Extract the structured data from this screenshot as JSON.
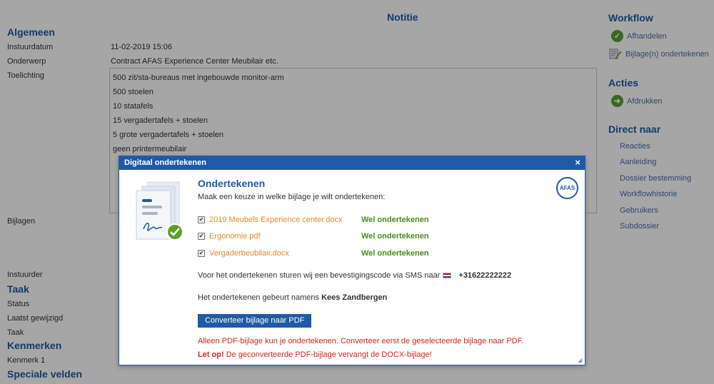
{
  "page": {
    "title": "Notitie"
  },
  "general": {
    "heading": "Algemeen",
    "fields": [
      {
        "label": "Instuurdatum",
        "value": "11-02-2019 15:06"
      },
      {
        "label": "Onderwerp",
        "value": "Contract AFAS Experience Center Meubilair etc."
      },
      {
        "label": "Toelichting",
        "value": ""
      }
    ],
    "description_lines": [
      "500 zit/sta-bureaus met ingebouwde monitor-arm",
      "500 stoelen",
      "10 statafels",
      "15 vergadertafels + stoelen",
      "5 grote vergadertafels + stoelen",
      "geen printermeubilair"
    ],
    "attachments_label": "Bijlagen",
    "submitter_label": "Instuurder"
  },
  "task": {
    "heading": "Taak",
    "fields": [
      "Status",
      "Laatst gewijzigd",
      "Taak"
    ]
  },
  "features": {
    "heading": "Kenmerken",
    "fields": [
      "Kenmerk 1"
    ]
  },
  "special": {
    "heading": "Speciale velden"
  },
  "workflow": {
    "heading": "Workflow",
    "items": [
      "Afhandelen",
      "Bijlage(n) ondertekenen"
    ]
  },
  "actions": {
    "heading": "Acties",
    "items": [
      "Afdrukken"
    ]
  },
  "direct": {
    "heading": "Direct naar",
    "items": [
      "Reacties",
      "Aanleiding",
      "Dossier bestemming",
      "Workflowhistorie",
      "Gebruikers",
      "Subdossier"
    ]
  },
  "modal": {
    "header": "Digitaal ondertekenen",
    "close_glyph": "×",
    "title": "Ondertekenen",
    "subtitle": "Maak een keuze in welke bijlage je wilt ondertekenen:",
    "files": [
      {
        "name": "2019 Meubels Experience center.docx",
        "action": "Wel ondertekenen",
        "checked": true
      },
      {
        "name": "Ergonomie.pdf",
        "action": "Wel ondertekenen",
        "checked": true
      },
      {
        "name": "Vergaderbeubilair.docx",
        "action": "Wel ondertekenen",
        "checked": true
      }
    ],
    "sms_text": "Voor het ondertekenen sturen wij een bevestigingscode via SMS naar",
    "phone": "+31622222222",
    "behalf_text": "Het ondertekenen gebeurt namens",
    "behalf_name": "Kees Zandbergen",
    "convert_button": "Converteer bijlage naar PDF",
    "warning_1": "Alleen PDF-bijlage kun je ondertekenen. Converteer eerst de geselecteerde bijlage naar PDF.",
    "warning_2_bold": "Let op!",
    "warning_2_rest": " De geconverteerde PDF-bijlage vervangt de DOCX-bijlage!",
    "logo_text": "AFAS"
  },
  "colors": {
    "accent": "#1f5aa6",
    "link_orange": "#e08a2c",
    "sign_green": "#4a8a1c",
    "warning_red": "#d9231e",
    "check_green": "#5aa02c"
  }
}
